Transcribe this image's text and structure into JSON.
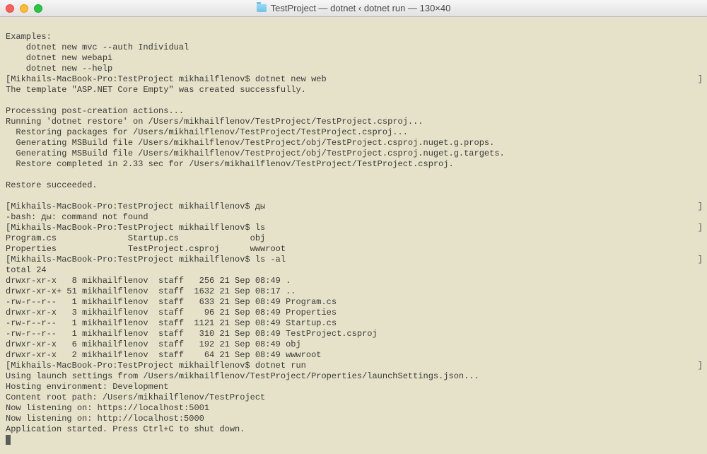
{
  "title": "TestProject — dotnet ‹ dotnet run — 130×40",
  "prompt": "Mikhails-MacBook-Pro:TestProject mikhailflenov$",
  "lines": [
    {
      "t": "",
      "scroll": false
    },
    {
      "t": "Examples:",
      "scroll": false
    },
    {
      "t": "    dotnet new mvc --auth Individual",
      "scroll": false
    },
    {
      "t": "    dotnet new webapi",
      "scroll": false
    },
    {
      "t": "    dotnet new --help",
      "scroll": false
    },
    {
      "t": "[Mikhails-MacBook-Pro:TestProject mikhailflenov$ dotnet new web",
      "scroll": true
    },
    {
      "t": "The template \"ASP.NET Core Empty\" was created successfully.",
      "scroll": false
    },
    {
      "t": "",
      "scroll": false
    },
    {
      "t": "Processing post-creation actions...",
      "scroll": false
    },
    {
      "t": "Running 'dotnet restore' on /Users/mikhailflenov/TestProject/TestProject.csproj...",
      "scroll": false
    },
    {
      "t": "  Restoring packages for /Users/mikhailflenov/TestProject/TestProject.csproj...",
      "scroll": false
    },
    {
      "t": "  Generating MSBuild file /Users/mikhailflenov/TestProject/obj/TestProject.csproj.nuget.g.props.",
      "scroll": false
    },
    {
      "t": "  Generating MSBuild file /Users/mikhailflenov/TestProject/obj/TestProject.csproj.nuget.g.targets.",
      "scroll": false
    },
    {
      "t": "  Restore completed in 2.33 sec for /Users/mikhailflenov/TestProject/TestProject.csproj.",
      "scroll": false
    },
    {
      "t": "",
      "scroll": false
    },
    {
      "t": "Restore succeeded.",
      "scroll": false
    },
    {
      "t": "",
      "scroll": false
    },
    {
      "t": "[Mikhails-MacBook-Pro:TestProject mikhailflenov$ ды",
      "scroll": true
    },
    {
      "t": "-bash: ды: command not found",
      "scroll": false
    },
    {
      "t": "[Mikhails-MacBook-Pro:TestProject mikhailflenov$ ls",
      "scroll": true
    },
    {
      "t": "Program.cs              Startup.cs              obj",
      "scroll": false
    },
    {
      "t": "Properties              TestProject.csproj      wwwroot",
      "scroll": false
    },
    {
      "t": "[Mikhails-MacBook-Pro:TestProject mikhailflenov$ ls -al",
      "scroll": true
    },
    {
      "t": "total 24",
      "scroll": false
    },
    {
      "t": "drwxr-xr-x   8 mikhailflenov  staff   256 21 Sep 08:49 .",
      "scroll": false
    },
    {
      "t": "drwxr-xr-x+ 51 mikhailflenov  staff  1632 21 Sep 08:17 ..",
      "scroll": false
    },
    {
      "t": "-rw-r--r--   1 mikhailflenov  staff   633 21 Sep 08:49 Program.cs",
      "scroll": false
    },
    {
      "t": "drwxr-xr-x   3 mikhailflenov  staff    96 21 Sep 08:49 Properties",
      "scroll": false
    },
    {
      "t": "-rw-r--r--   1 mikhailflenov  staff  1121 21 Sep 08:49 Startup.cs",
      "scroll": false
    },
    {
      "t": "-rw-r--r--   1 mikhailflenov  staff   310 21 Sep 08:49 TestProject.csproj",
      "scroll": false
    },
    {
      "t": "drwxr-xr-x   6 mikhailflenov  staff   192 21 Sep 08:49 obj",
      "scroll": false
    },
    {
      "t": "drwxr-xr-x   2 mikhailflenov  staff    64 21 Sep 08:49 wwwroot",
      "scroll": false
    },
    {
      "t": "[Mikhails-MacBook-Pro:TestProject mikhailflenov$ dotnet run",
      "scroll": true
    },
    {
      "t": "Using launch settings from /Users/mikhailflenov/TestProject/Properties/launchSettings.json...",
      "scroll": false
    },
    {
      "t": "Hosting environment: Development",
      "scroll": false
    },
    {
      "t": "Content root path: /Users/mikhailflenov/TestProject",
      "scroll": false
    },
    {
      "t": "Now listening on: https://localhost:5001",
      "scroll": false
    },
    {
      "t": "Now listening on: http://localhost:5000",
      "scroll": false
    },
    {
      "t": "Application started. Press Ctrl+C to shut down.",
      "scroll": false
    }
  ]
}
